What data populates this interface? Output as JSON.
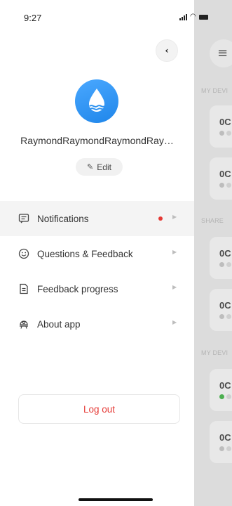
{
  "status_bar": {
    "time": "9:27"
  },
  "drawer": {
    "username": "RaymondRaymondRaymondRay…",
    "edit_label": "Edit",
    "menu": [
      {
        "label": "Notifications",
        "icon": "message-icon",
        "badge": true
      },
      {
        "label": "Questions & Feedback",
        "icon": "smile-icon",
        "badge": false
      },
      {
        "label": "Feedback progress",
        "icon": "document-icon",
        "badge": false
      },
      {
        "label": "About app",
        "icon": "robot-icon",
        "badge": false
      }
    ],
    "logout_label": "Log out",
    "colors": {
      "accent": "#1f86ea",
      "danger": "#e53935"
    }
  },
  "background": {
    "sections": [
      "MY DEVI",
      "SHARE",
      "MY DEVI"
    ],
    "cards": [
      {
        "name": "0C",
        "online": false
      },
      {
        "name": "0C",
        "online": false
      },
      {
        "name": "0C",
        "online": false
      },
      {
        "name": "0C",
        "online": false
      },
      {
        "name": "0C",
        "online": true
      },
      {
        "name": "0C",
        "online": false
      }
    ]
  }
}
